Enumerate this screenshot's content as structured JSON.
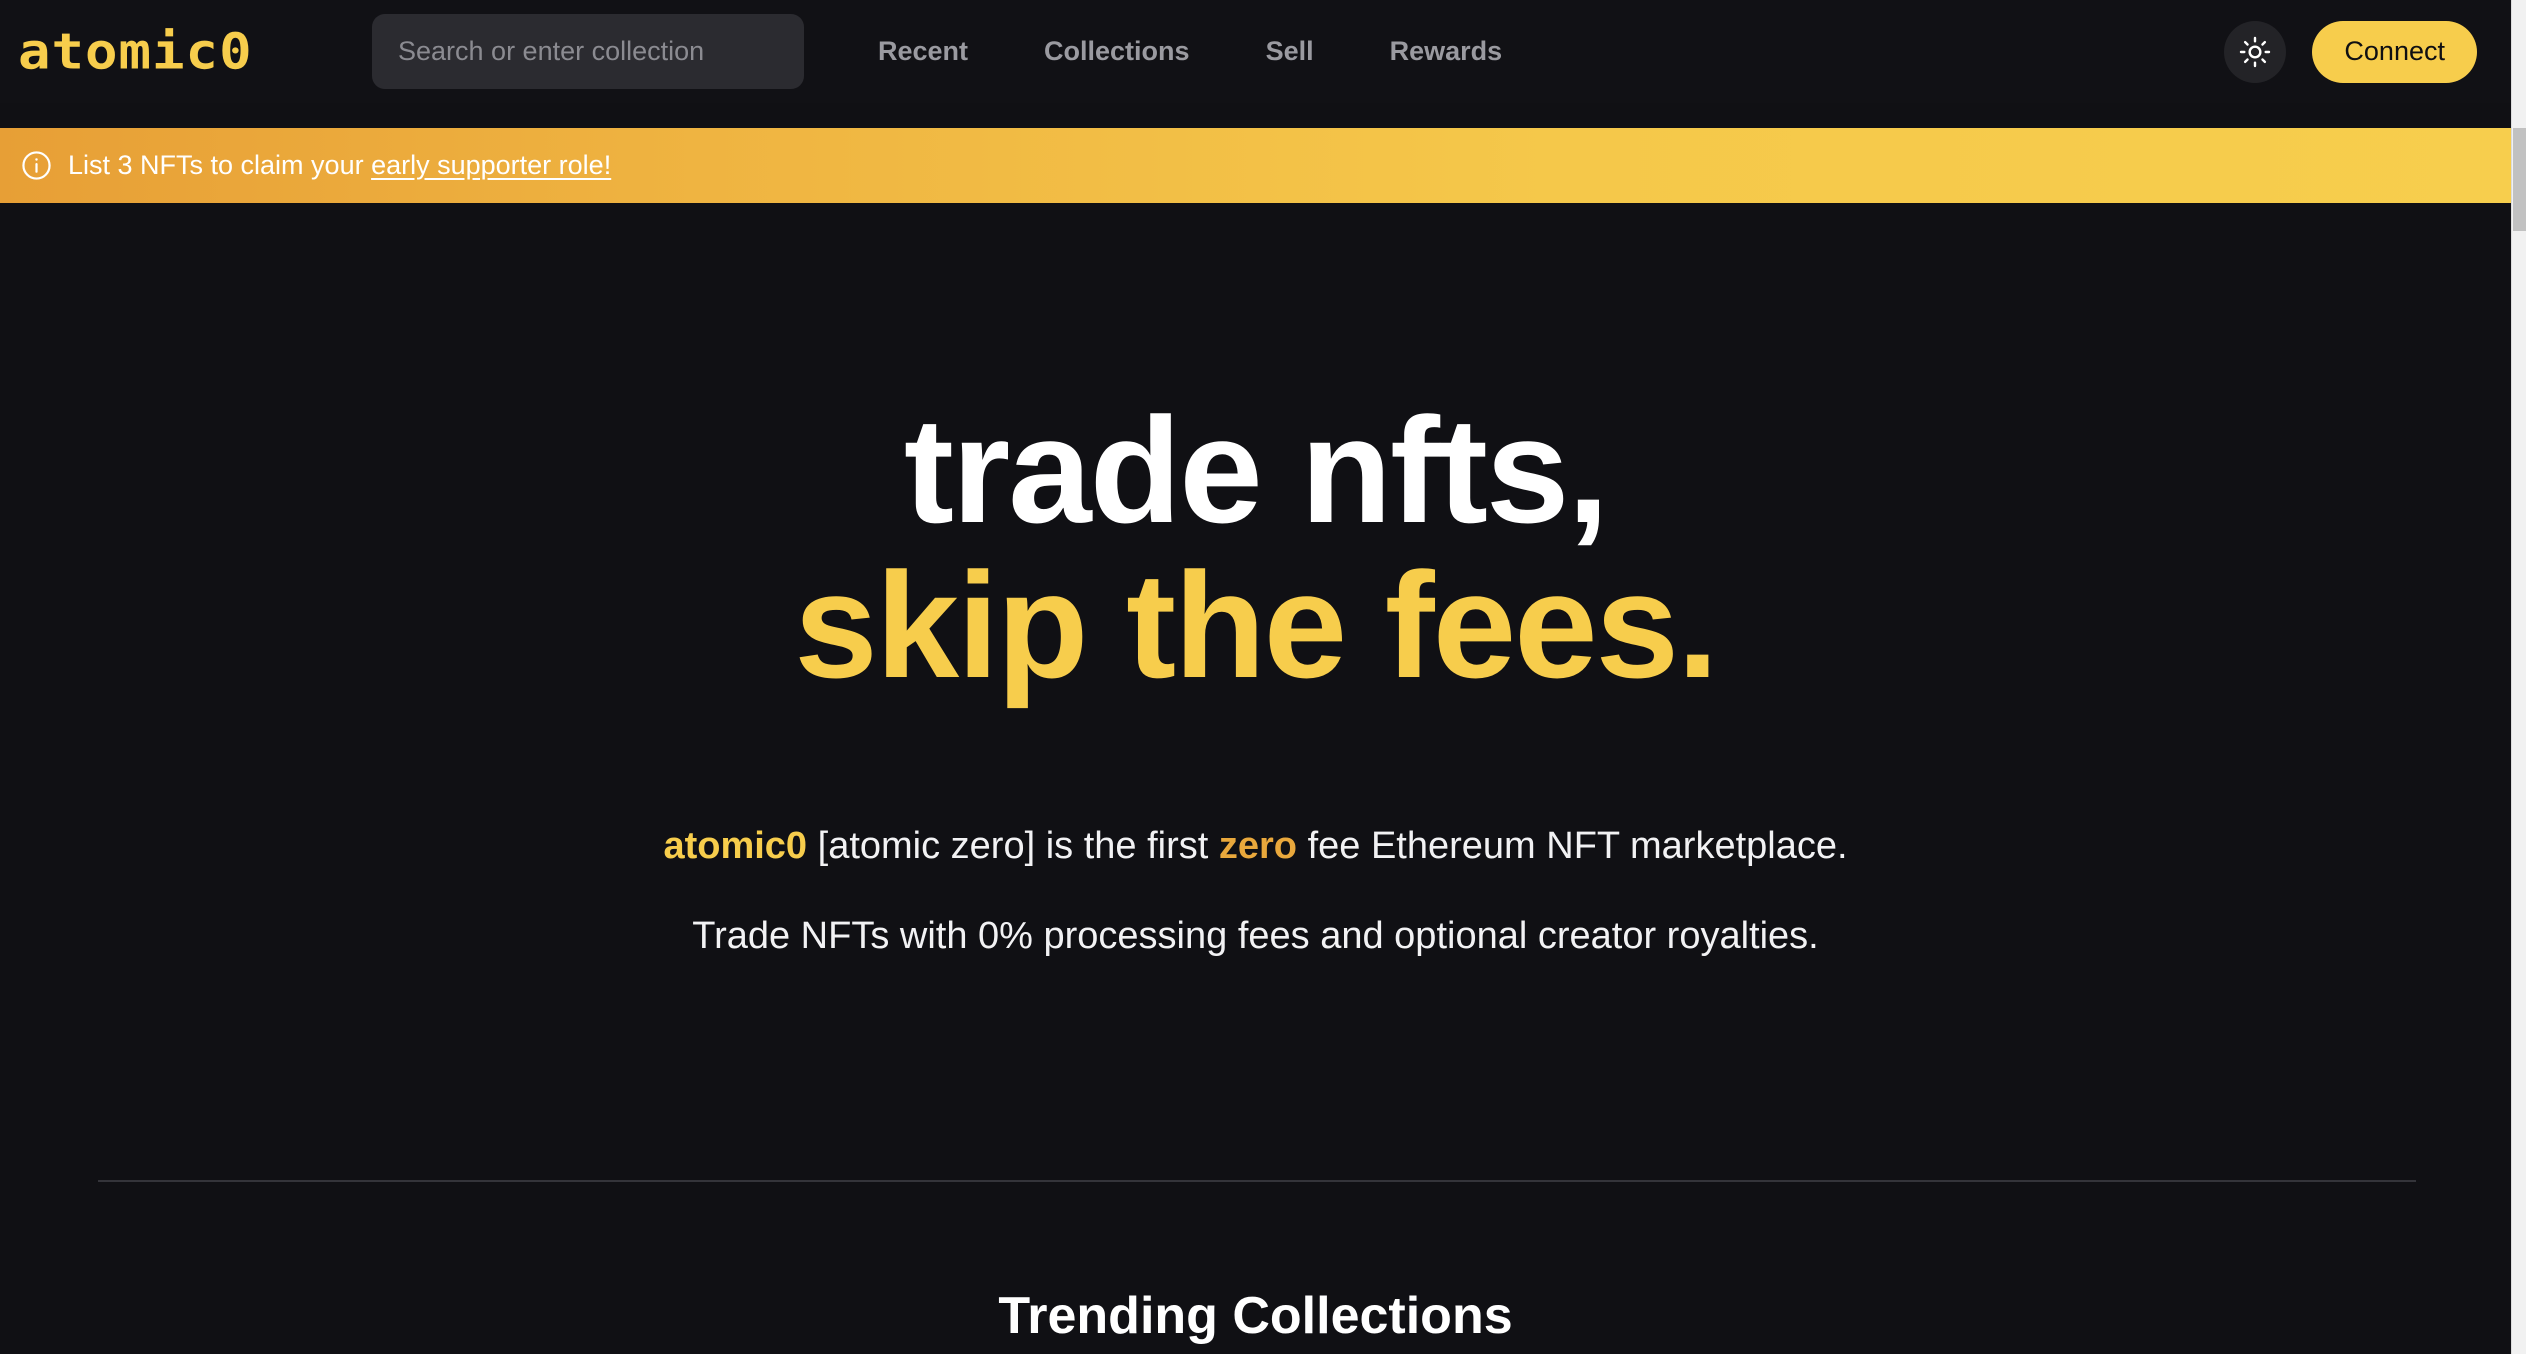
{
  "header": {
    "logo_text": "atomic0",
    "search": {
      "placeholder": "Search or enter collection",
      "value": ""
    },
    "nav": [
      {
        "label": "Recent"
      },
      {
        "label": "Collections"
      },
      {
        "label": "Sell"
      },
      {
        "label": "Rewards"
      }
    ],
    "theme_toggle_icon": "sun-icon",
    "connect_label": "Connect"
  },
  "banner": {
    "icon": "info-circle-icon",
    "text_prefix": "List 3 NFTs to claim your ",
    "link_label": "early supporter role!"
  },
  "hero": {
    "title_line1": "trade nfts,",
    "title_line2": "skip the fees.",
    "subtitle_brand": "atomic0",
    "subtitle_part1": " [atomic zero] is the first ",
    "subtitle_highlight": "zero",
    "subtitle_part2": " fee Ethereum NFT marketplace.",
    "subtitle2": "Trade NFTs with 0% processing fees and optional creator royalties."
  },
  "sections": {
    "trending_title": "Trending Collections"
  },
  "colors": {
    "brand_yellow": "#F7CD4C",
    "banner_orange": "#E79F36",
    "background": "#101014",
    "header_background": "#111115",
    "nav_text": "#9A9AA0",
    "search_background": "#2B2B30",
    "divider": "#34343A"
  }
}
